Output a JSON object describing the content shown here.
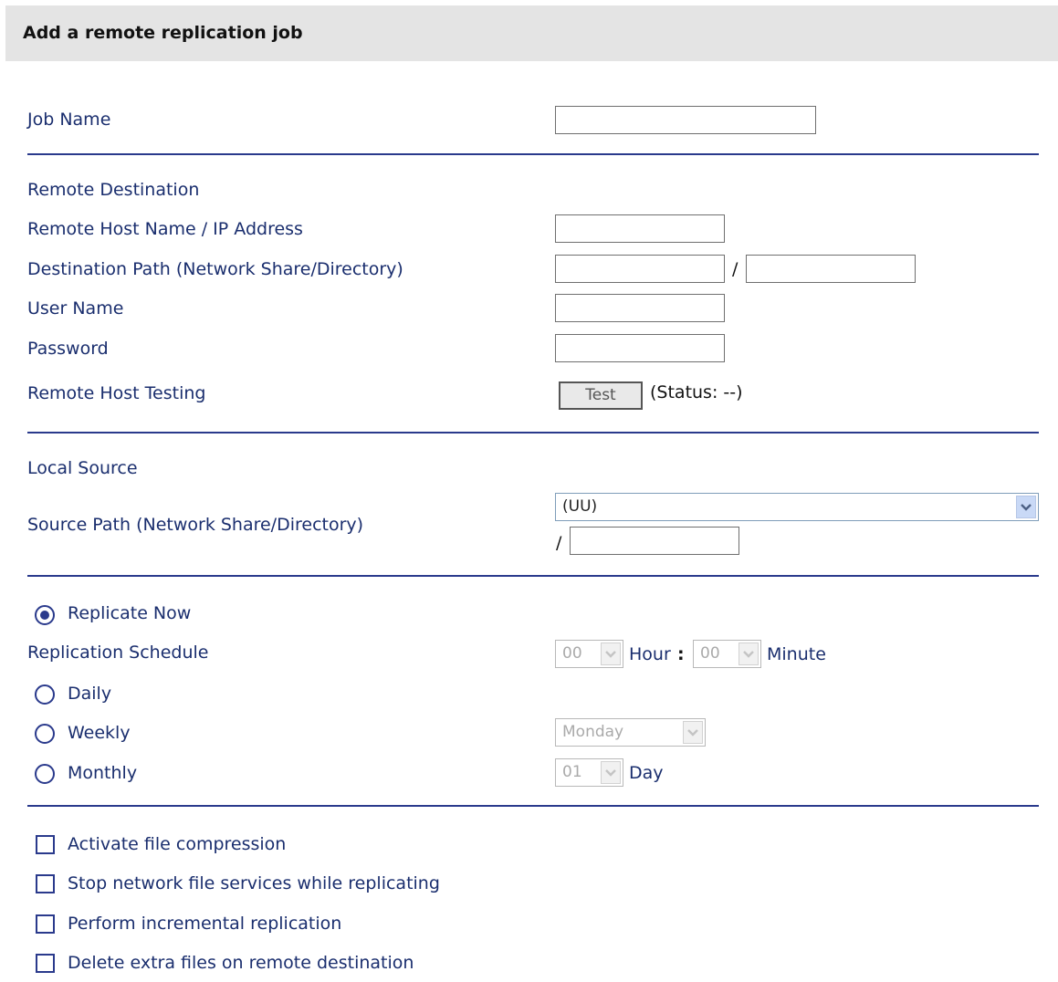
{
  "title": "Add a remote replication job",
  "job_name": {
    "label": "Job Name",
    "value": ""
  },
  "remote": {
    "section_label": "Remote Destination",
    "host_label": "Remote Host Name / IP Address",
    "host_value": "",
    "path_label": "Destination Path (Network Share/Directory)",
    "path_share_value": "",
    "path_separator": "/",
    "path_dir_value": "",
    "user_label": "User Name",
    "user_value": "",
    "password_label": "Password",
    "password_value": "",
    "testing_label": "Remote Host Testing",
    "test_button": "Test",
    "status_text": "(Status: --)"
  },
  "local": {
    "section_label": "Local Source",
    "path_label": "Source Path (Network Share/Directory)",
    "share_selected": "(UU)",
    "path_separator": "/",
    "dir_value": ""
  },
  "schedule": {
    "replicate_now_label": "Replicate Now",
    "replicate_now_checked": true,
    "schedule_label": "Replication Schedule",
    "hour_value": "00",
    "hour_label": "Hour",
    "time_separator": ":",
    "minute_value": "00",
    "minute_label": "Minute",
    "daily_label": "Daily",
    "weekly_label": "Weekly",
    "weekday_value": "Monday",
    "monthly_label": "Monthly",
    "day_value": "01",
    "day_label": "Day"
  },
  "options": [
    {
      "label": "Activate file compression",
      "checked": false
    },
    {
      "label": "Stop network file services while replicating",
      "checked": false
    },
    {
      "label": "Perform incremental replication",
      "checked": false
    },
    {
      "label": "Delete extra files on remote destination",
      "checked": false
    }
  ],
  "colors": {
    "label_text": "#1a2e6e",
    "divider": "#2a3a8c",
    "header_bg": "#e4e4e4"
  },
  "icons": {
    "dropdown": "chevron-down-icon",
    "radio": "radio-icon",
    "checkbox": "checkbox-icon"
  }
}
